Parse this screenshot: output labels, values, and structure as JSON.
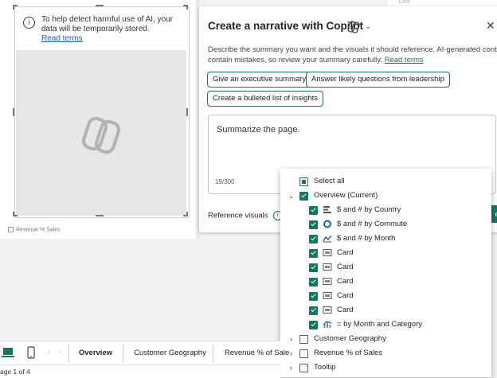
{
  "notice": {
    "text": "To help detect harmful use of AI, your data will be temporarily stored.",
    "link": "Read terms"
  },
  "canvas_label": "Revenue % Sales",
  "right_canvas_label": "1,000",
  "panel": {
    "title": "Create a narrative with Copilot",
    "description": "Describe the summary you want and the visuals it should reference. AI-generated content can contain mistakes, so review your summary carefully.",
    "desc_line1": "Describe the summary you want and the visuals it should reference. AI-generated content can",
    "desc_line2": "contain mistakes, so review your summary carefully.",
    "read_terms": "Read terms",
    "chips": [
      "Give an executive summary",
      "Answer likely questions from leadership",
      "Create a bulleted list of insights"
    ],
    "prompt_text": "Summarize the page.",
    "char_count": "19/300",
    "reference_visuals": "Reference visuals",
    "generate_label": "e"
  },
  "dropdown": {
    "select_all": "Select all",
    "group_overview": "Overview (Current)",
    "visuals": [
      {
        "label": "$ and # by Country",
        "icon": "bar-chart-icon"
      },
      {
        "label": "$ and # by Commute",
        "icon": "donut-chart-icon"
      },
      {
        "label": "$ and # by Month",
        "icon": "area-chart-icon"
      },
      {
        "label": "Card",
        "icon": "card-icon"
      },
      {
        "label": "Card",
        "icon": "card-icon"
      },
      {
        "label": "Card",
        "icon": "card-icon"
      },
      {
        "label": "Card",
        "icon": "card-icon"
      },
      {
        "label": "Card",
        "icon": "card-icon"
      },
      {
        "label": "= by Month and Category",
        "icon": "line-column-chart-icon"
      }
    ],
    "pages": [
      "Customer Geography",
      "Revenue % of Sales",
      "Tooltip"
    ]
  },
  "tabs": [
    "Overview",
    "Customer Geography",
    "Revenue % of Sale"
  ],
  "status": "age 1 of 4",
  "colors": {
    "accent": "#117865",
    "link": "#1b5fb4"
  }
}
